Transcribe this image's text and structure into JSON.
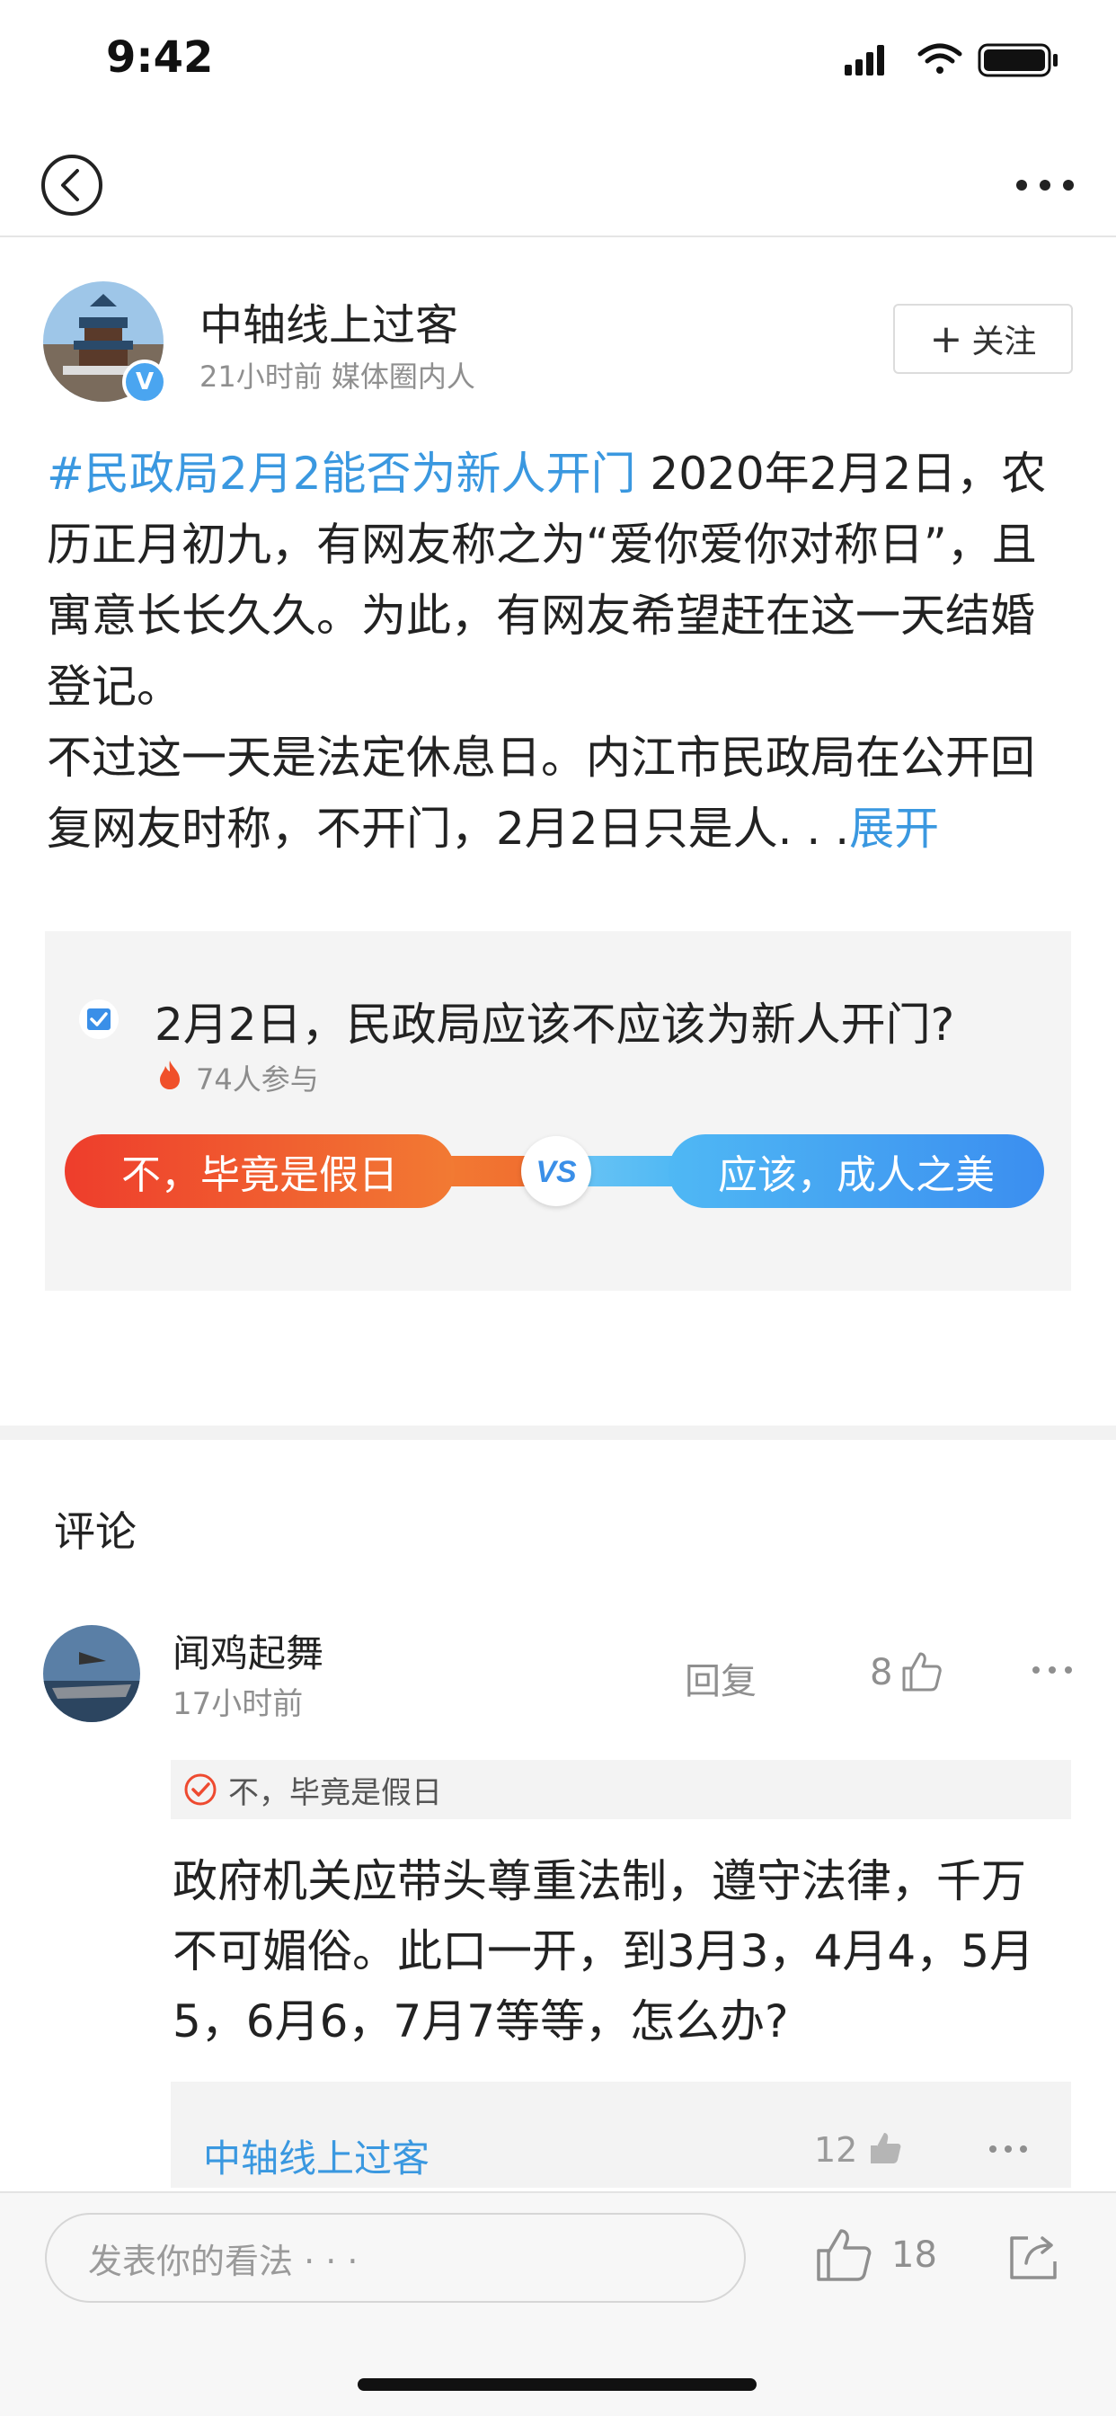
{
  "status_bar": {
    "time": "9:42"
  },
  "nav": {
    "back_icon": "back-icon",
    "more_icon": "more-icon"
  },
  "author": {
    "name": "中轴线上过客",
    "meta": "21小时前  媒体圈内人",
    "badge": "V",
    "follow_label": "关注",
    "follow_plus": "+"
  },
  "post": {
    "hashtag": "#民政局2月2能否为新人开门",
    "text": " 2020年2月2日，农历正月初九，有网友称之为“爱你爱你对称日”，且寓意长长久久。为此，有网友希望赶在这一天结婚登记。",
    "text2": "不过这一天是法定休息日。内江市民政局在公开回复网友时称，不开门，2月2日只是人. . .",
    "expand_label": "展开"
  },
  "poll": {
    "question": "2月2日，民政局应该不应该为新人开门?",
    "participants": "74人参与",
    "option_left": "不，毕竟是假日",
    "option_right": "应该，成人之美",
    "vs_label": "VS"
  },
  "comments_section": {
    "title": "评论"
  },
  "comment": {
    "name": "闻鸡起舞",
    "time": "17小时前",
    "reply_label": "回复",
    "likes": "8",
    "vote_tag": "不，毕竟是假日",
    "text": "政府机关应带头尊重法制，遵守法律，千万不可媚俗。此口一开，到3月3，4月4，5月5，6月6，7月7等等，怎么办?",
    "reply": {
      "author": "中轴线上过客",
      "likes": "12"
    }
  },
  "bottom_bar": {
    "input_placeholder": "发表你的看法 · · ·",
    "likes": "18"
  },
  "colors": {
    "link": "#3a98e0",
    "vote_left": "#ee3d2c",
    "vote_right": "#3b8ef0"
  }
}
